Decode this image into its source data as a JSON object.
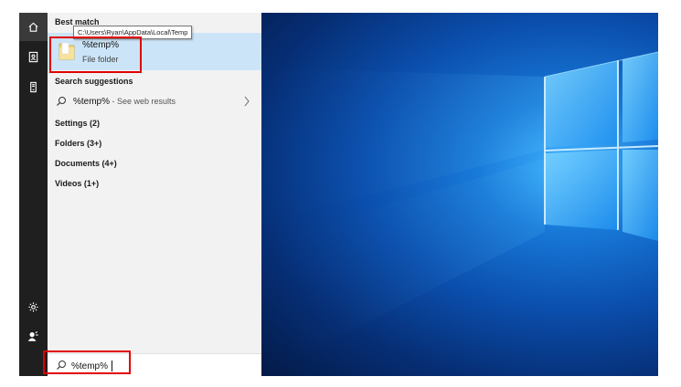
{
  "tooltip": {
    "path": "C:\\Users\\Ryan\\AppData\\Local\\Temp"
  },
  "results": {
    "best_match_heading": "Best match",
    "best_match": {
      "title": "%temp%",
      "subtitle": "File folder"
    },
    "search_suggestions_heading": "Search suggestions",
    "web_suggestion": {
      "query": "%temp%",
      "hint": " - See web results"
    },
    "categories": [
      "Settings (2)",
      "Folders (3+)",
      "Documents (4+)",
      "Videos (1+)"
    ]
  },
  "search": {
    "value": "%temp%"
  },
  "rail": {
    "icons": [
      "home-icon",
      "person-pin-icon",
      "tower-icon",
      "settings-gear-icon",
      "power-user-icon"
    ]
  },
  "colors": {
    "highlight": "#e00000",
    "best_match_bg": "#cce4f7",
    "rail_bg": "#1f1f1f"
  }
}
